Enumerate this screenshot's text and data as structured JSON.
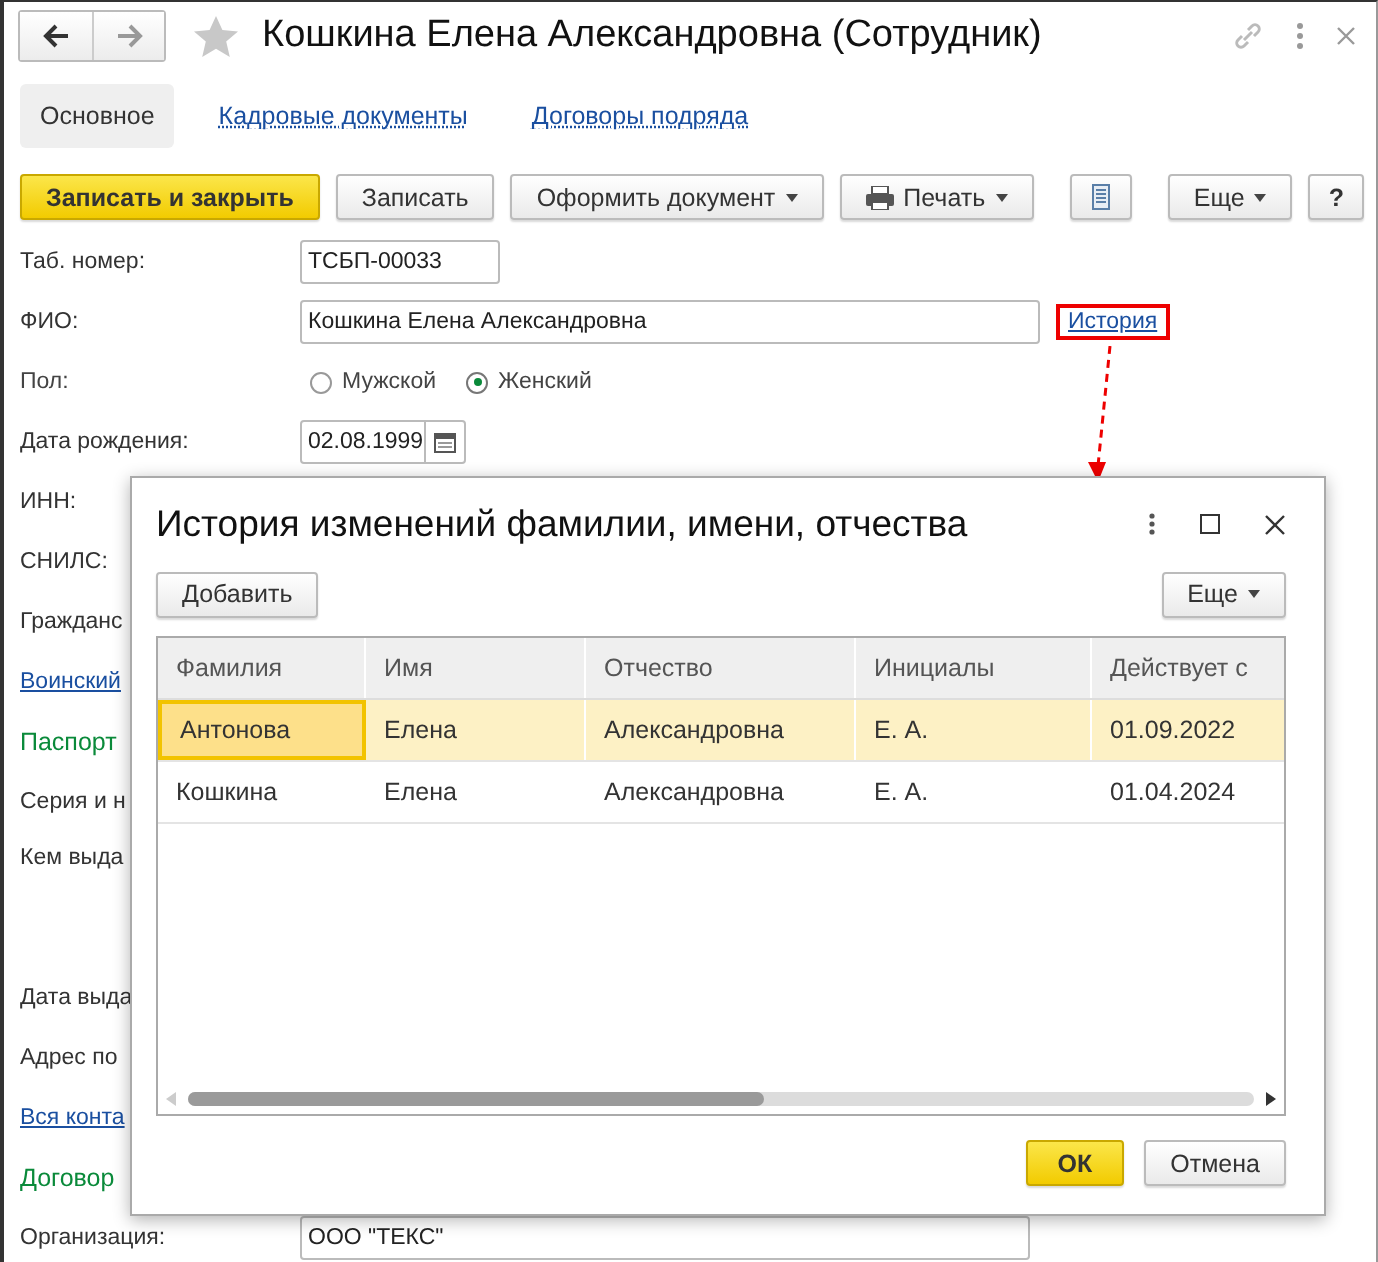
{
  "window": {
    "title": "Кошкина Елена Александровна (Сотрудник)"
  },
  "tabs": [
    {
      "label": "Основное",
      "selected": true
    },
    {
      "label": "Кадровые документы",
      "selected": false
    },
    {
      "label": "Договоры подряда",
      "selected": false
    }
  ],
  "toolbar": {
    "left": [
      {
        "label": "Записать и закрыть",
        "kind": "primary"
      },
      {
        "label": "Записать",
        "kind": "plain"
      },
      {
        "label": "Оформить документ",
        "kind": "dropdown"
      },
      {
        "label": "Печать",
        "kind": "print"
      },
      {
        "kind": "report"
      }
    ],
    "right": [
      {
        "label": "Еще",
        "kind": "dropdown"
      },
      {
        "label": "?",
        "kind": "plain"
      }
    ]
  },
  "form": [
    {
      "kind": "field",
      "label": "Таб. номер:",
      "value": "ТСБП-00033"
    },
    {
      "kind": "fio",
      "label": "ФИО:",
      "value": "Кошкина Елена Александровна",
      "link": "История"
    },
    {
      "kind": "radio",
      "label": "Пол:",
      "options": [
        {
          "label": "Мужской",
          "selected": false
        },
        {
          "label": "Женский",
          "selected": true
        }
      ]
    },
    {
      "kind": "date",
      "label": "Дата рождения:",
      "value": "02.08.1999"
    },
    {
      "kind": "label",
      "label": "ИНН:"
    },
    {
      "kind": "label",
      "label": "СНИЛС:"
    },
    {
      "kind": "label",
      "label": "Гражданс"
    },
    {
      "kind": "link",
      "label": "Воинский"
    },
    {
      "kind": "section",
      "label": "Паспорт"
    },
    {
      "kind": "label",
      "label": "Серия и н"
    },
    {
      "kind": "tall",
      "label": "Кем выда"
    },
    {
      "kind": "label",
      "label": "Дата выда"
    },
    {
      "kind": "label",
      "label": "Адрес по"
    },
    {
      "kind": "link",
      "label": "Вся конта"
    },
    {
      "kind": "section",
      "label": "Договор"
    },
    {
      "kind": "select",
      "label": "Организация:",
      "value": "ООО \"ТЕКС\""
    }
  ],
  "dialog": {
    "title": "История изменений фамилии, имени, отчества",
    "add_button": "Добавить",
    "more_button": "Еще",
    "columns": [
      "Фамилия",
      "Имя",
      "Отчество",
      "Инициалы",
      "Действует с"
    ],
    "rows": [
      {
        "cells": [
          "Антонова",
          "Елена",
          "Александровна",
          "Е. А.",
          "01.09.2022"
        ],
        "selected": true
      },
      {
        "cells": [
          "Кошкина",
          "Елена",
          "Александровна",
          "Е. А.",
          "01.04.2024"
        ],
        "selected": false
      }
    ],
    "ok": "ОК",
    "cancel": "Отмена"
  }
}
